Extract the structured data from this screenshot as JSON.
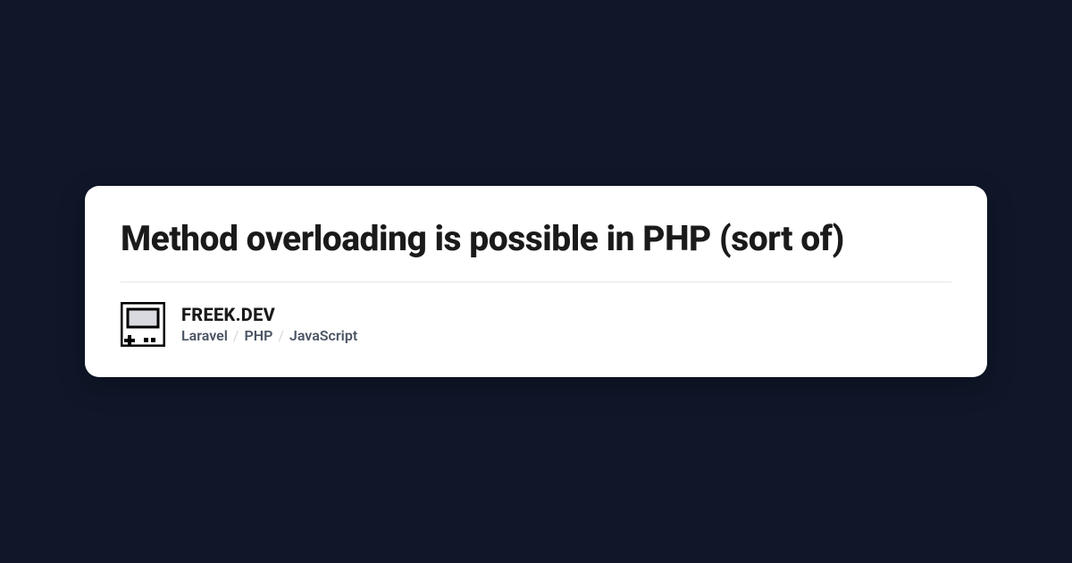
{
  "card": {
    "title": "Method overloading is possible in PHP (sort of)",
    "site_name": "FREEK.DEV",
    "tags": [
      "Laravel",
      "PHP",
      "JavaScript"
    ]
  }
}
